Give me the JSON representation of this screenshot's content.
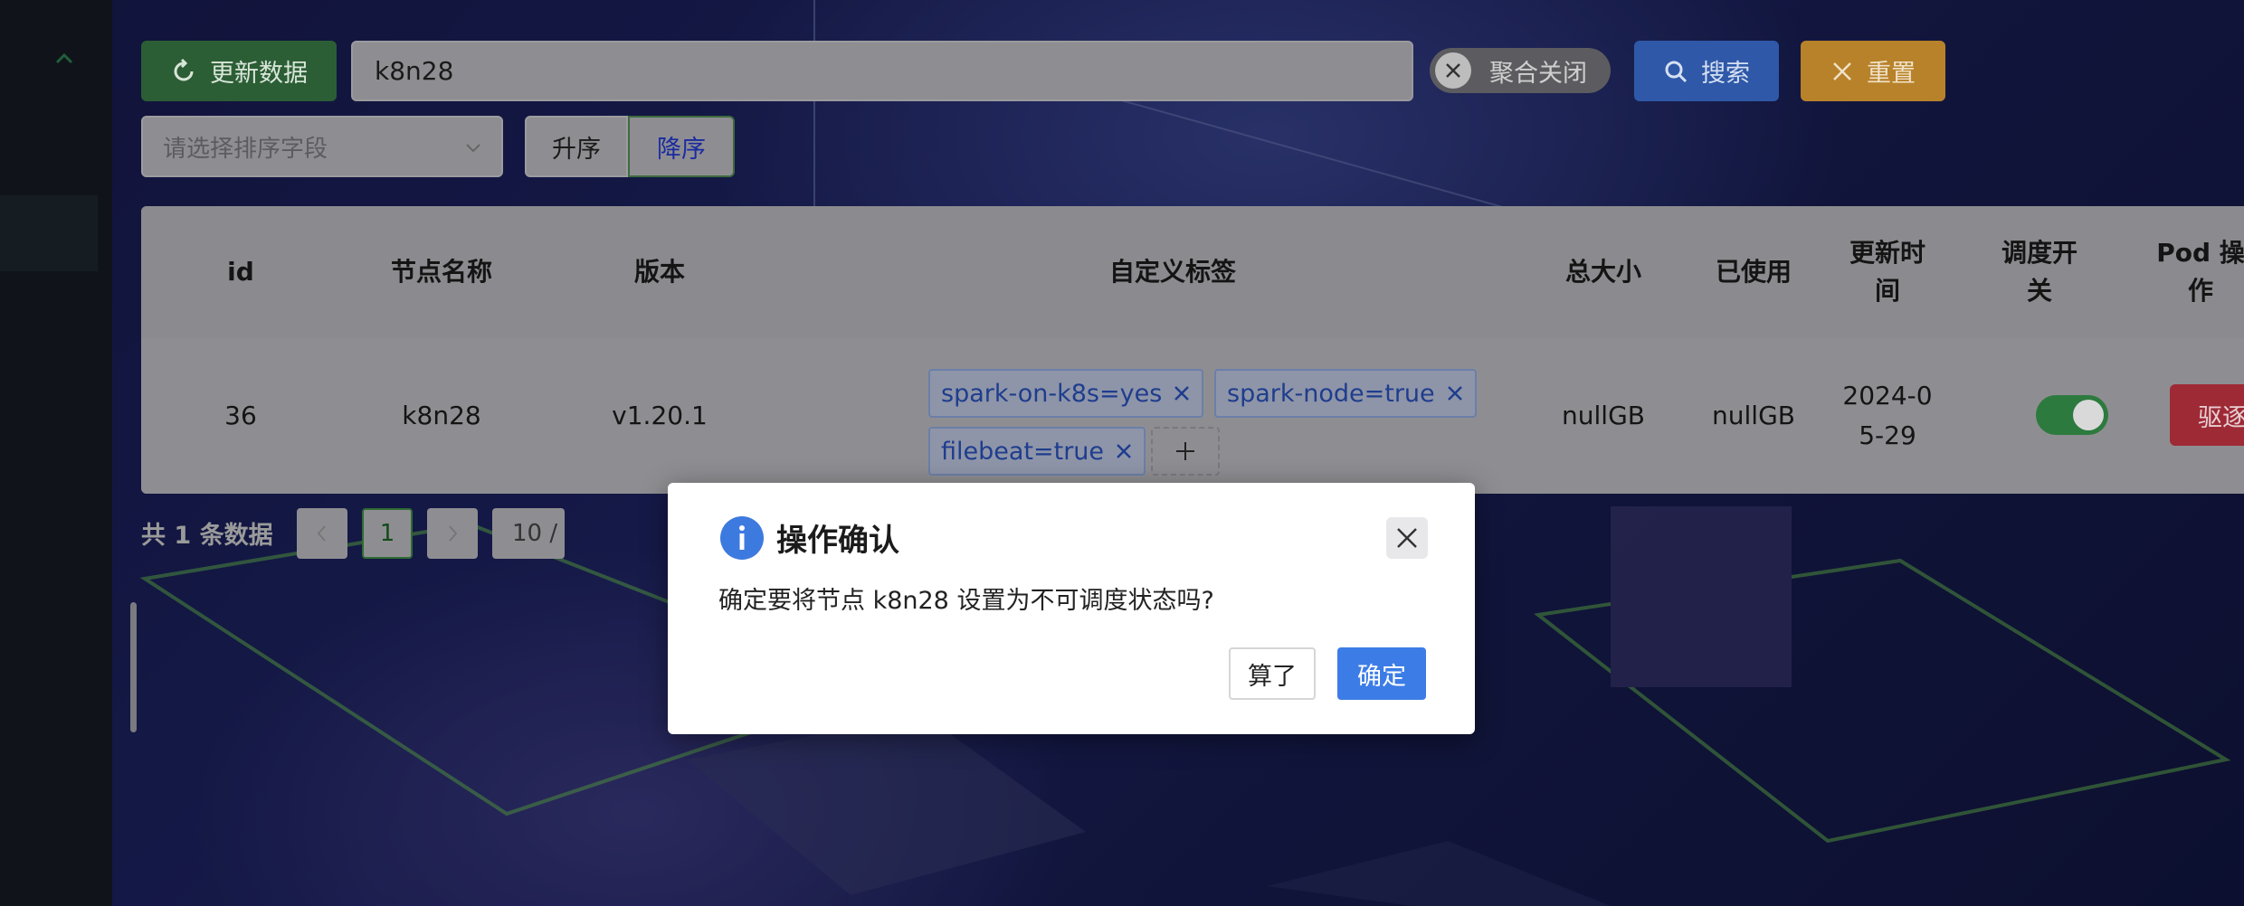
{
  "toolbar": {
    "refresh_label": "更新数据",
    "search_value": "k8n28",
    "merge_toggle_label": "聚合关闭",
    "merge_toggle_on": false,
    "search_label": "搜索",
    "reset_label": "重置"
  },
  "sort": {
    "placeholder": "请选择排序字段",
    "asc_label": "升序",
    "desc_label": "降序",
    "selected": "降序"
  },
  "table": {
    "headers": {
      "id": "id",
      "name": "节点名称",
      "version": "版本",
      "labels": "自定义标签",
      "total": "总大小",
      "used": "已使用",
      "updated": "更新时间",
      "schedulable": "调度开关",
      "pod_ops": "Pod 操作"
    },
    "row": {
      "id": "36",
      "name": "k8n28",
      "version": "v1.20.1",
      "tags": [
        "spark-on-k8s=yes",
        "spark-node=true",
        "filebeat=true"
      ],
      "total": "nullGB",
      "used": "nullGB",
      "updated": "2024-05-29",
      "schedulable": true,
      "evict_label": "驱逐"
    }
  },
  "pagination": {
    "total_text": "共 1 条数据",
    "current_page": "1",
    "page_size": "10 /"
  },
  "modal": {
    "title": "操作确认",
    "message": "确定要将节点 k8n28 设置为不可调度状态吗?",
    "cancel_label": "算了",
    "ok_label": "确定"
  },
  "colors": {
    "primary": "#3c7ce6",
    "success": "#2c5e36",
    "warning": "#b8822a",
    "danger": "#9e2a36"
  },
  "icons": [
    "chevron-up-icon",
    "refresh-icon",
    "close-icon",
    "search-icon",
    "chevron-down-icon",
    "chevron-left-icon",
    "chevron-right-icon",
    "plus-icon",
    "info-icon"
  ]
}
